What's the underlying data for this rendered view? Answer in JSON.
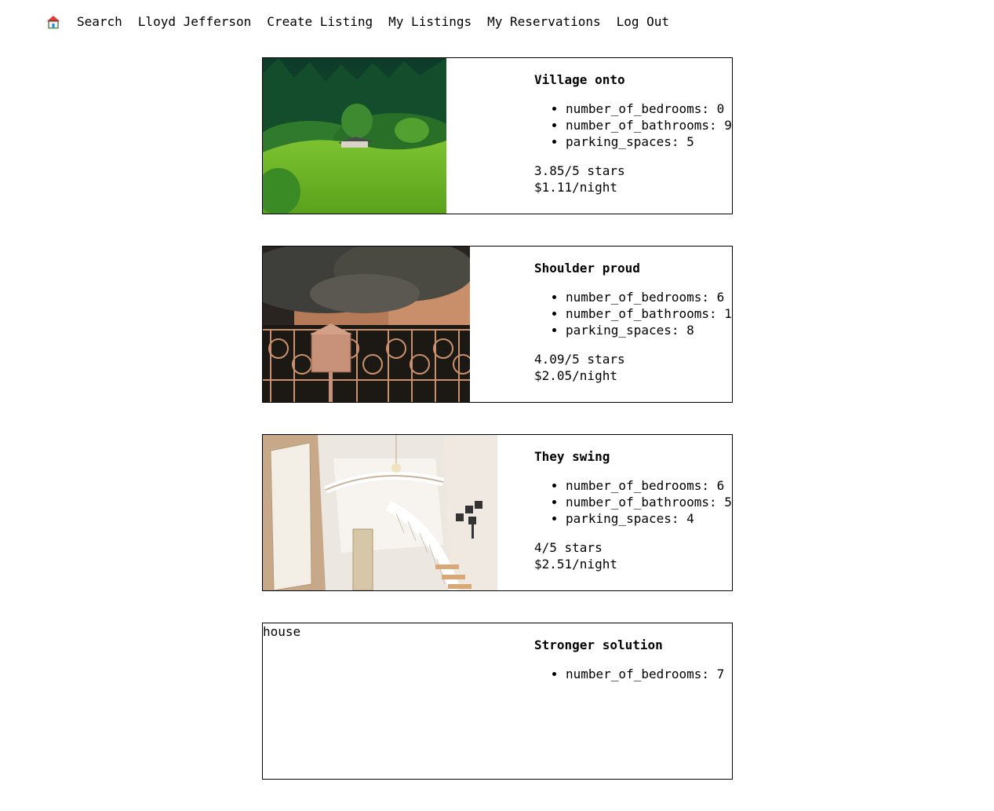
{
  "nav": {
    "home_icon": "house-icon",
    "links": [
      "Search",
      "Lloyd Jefferson",
      "Create Listing",
      "My Listings",
      "My Reservations",
      "Log Out"
    ]
  },
  "listings": [
    {
      "image": "green hillside meadow with small cabin",
      "title": "Village onto",
      "features": [
        "number_of_bedrooms: 0",
        "number_of_bathrooms: 9",
        "parking_spaces: 5"
      ],
      "rating": "3.85/5 stars",
      "price": "$1.11/night"
    },
    {
      "image": "ornate wrought iron gate with mailbox under tree",
      "title": "Shoulder proud",
      "features": [
        "number_of_bedrooms: 6",
        "number_of_bathrooms: 1",
        "parking_spaces: 8"
      ],
      "rating": "4.09/5 stars",
      "price": "$2.05/night"
    },
    {
      "image": "bright entry hall with curved staircase and chandelier",
      "title": "They swing",
      "features": [
        "number_of_bedrooms: 6",
        "number_of_bathrooms: 5",
        "parking_spaces: 4"
      ],
      "rating": "4/5 stars",
      "price": "$2.51/night"
    },
    {
      "image_alt": "house",
      "title": "Stronger solution",
      "features": [
        "number_of_bedrooms: 7"
      ]
    }
  ]
}
